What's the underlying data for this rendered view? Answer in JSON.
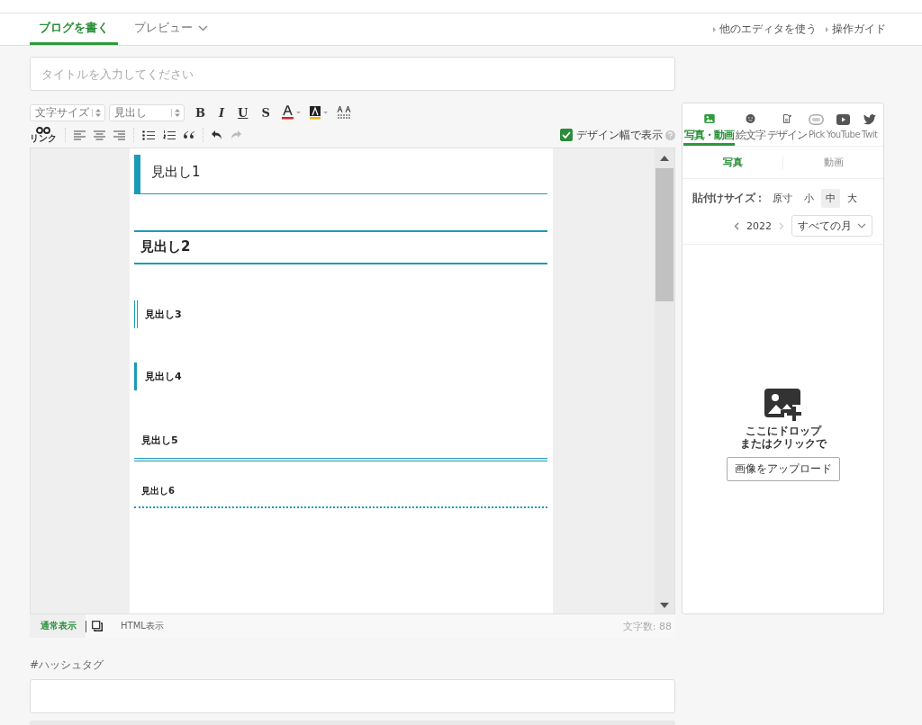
{
  "header": {
    "tabs": [
      {
        "label": "ブログを書く",
        "selected": true,
        "dropdown": false
      },
      {
        "label": "プレビュー",
        "selected": false,
        "dropdown": true
      }
    ],
    "links": [
      "他のエディタを使う",
      "操作ガイド"
    ]
  },
  "title_field": {
    "placeholder": "タイトルを入力してください"
  },
  "toolbar": {
    "selects": [
      "文字サイズ",
      "見出し"
    ],
    "format_buttons": [
      {
        "label": "B",
        "kind": "bold"
      },
      {
        "label": "I",
        "kind": "italic"
      },
      {
        "label": "U",
        "kind": "underline"
      },
      {
        "label": "S",
        "kind": "strike"
      }
    ],
    "link_label": "リンク",
    "design_width": {
      "label": "デザイン幅で表示",
      "checked": true
    }
  },
  "editor": {
    "headings": [
      {
        "kind": "h1",
        "text": "見出し1"
      },
      {
        "kind": "h2",
        "text": "見出し2"
      },
      {
        "kind": "h3",
        "text": "見出し3"
      },
      {
        "kind": "h4",
        "text": "見出し4"
      },
      {
        "kind": "h5",
        "text": "見出し5"
      },
      {
        "kind": "h6",
        "text": "見出し6"
      }
    ],
    "modes": [
      {
        "label": "通常表示",
        "selected": true
      },
      {
        "label": "HTML表示",
        "selected": false
      }
    ],
    "char_count": "文字数: 88"
  },
  "hashtag": {
    "label": "#ハッシュタグ"
  },
  "side_panel": {
    "tabs": [
      {
        "label": "写真・動画",
        "kind": "photo",
        "selected": true
      },
      {
        "label": "絵文字",
        "kind": "emoji",
        "selected": false
      },
      {
        "label": "デザイン",
        "kind": "design",
        "selected": false
      },
      {
        "label": "Pick",
        "kind": "pick",
        "selected": false
      },
      {
        "label": "YouTube",
        "kind": "youtube",
        "selected": false
      },
      {
        "label": "Twit",
        "kind": "twitter",
        "selected": false
      }
    ],
    "subtabs": [
      {
        "label": "写真",
        "selected": true
      },
      {
        "label": "動画",
        "selected": false
      }
    ],
    "size_label": "貼付けサイズ：",
    "sizes": [
      {
        "label": "原寸",
        "selected": false
      },
      {
        "label": "小",
        "selected": false
      },
      {
        "label": "中",
        "selected": true
      },
      {
        "label": "大",
        "selected": false
      }
    ],
    "year": "2022",
    "month_select": "すべての月",
    "drop_text": [
      "ここにドロップ",
      "またはクリックで"
    ],
    "upload_button": "画像をアップロード"
  }
}
